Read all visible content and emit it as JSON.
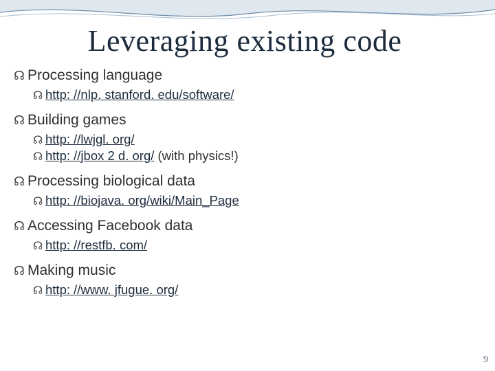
{
  "title": "Leveraging existing code",
  "page_number": "9",
  "sections": [
    {
      "heading": "Processing language",
      "items": [
        {
          "url": "http: //nlp. stanford. edu/software/",
          "trail": ""
        }
      ]
    },
    {
      "heading": "Building games",
      "items": [
        {
          "url": "http: //lwjgl. org/",
          "trail": ""
        },
        {
          "url": "http: //jbox 2 d. org/",
          "trail": " (with physics!)"
        }
      ]
    },
    {
      "heading": "Processing biological data",
      "items": [
        {
          "url": "http: //biojava. org/wiki/Main_Page",
          "trail": ""
        }
      ]
    },
    {
      "heading": "Accessing Facebook data",
      "items": [
        {
          "url": "http: //restfb. com/",
          "trail": ""
        }
      ]
    },
    {
      "heading": "Making music",
      "items": [
        {
          "url": "http: //www. jfugue. org/",
          "trail": ""
        }
      ]
    }
  ]
}
